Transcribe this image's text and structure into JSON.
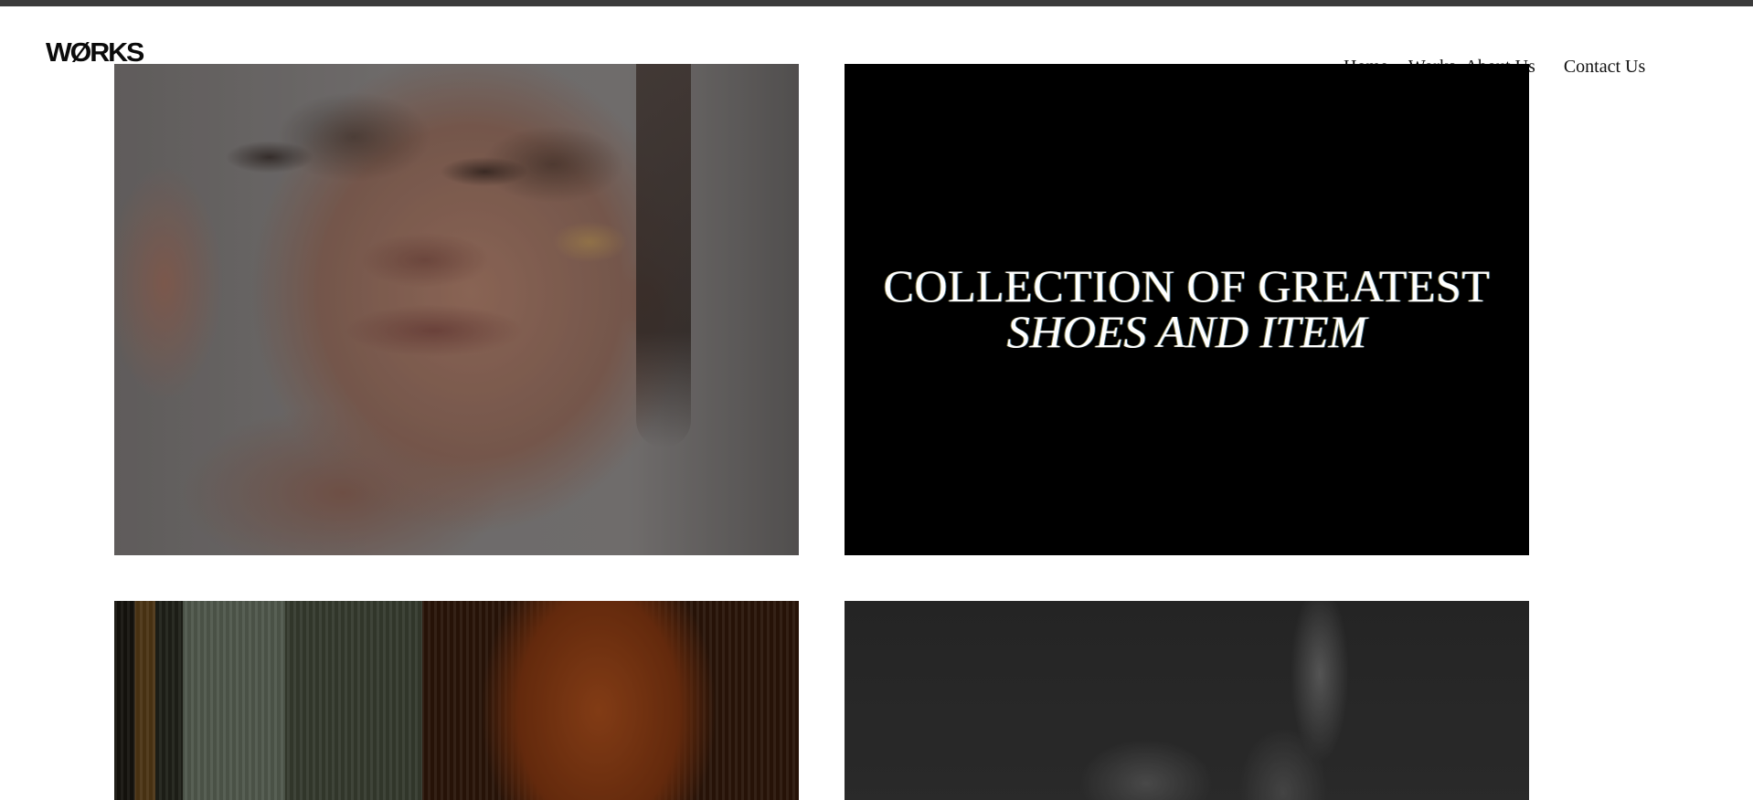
{
  "header": {
    "logo": "WØRKS",
    "nav": {
      "home": "Home",
      "works": "Works",
      "about": "About Us",
      "contact": "Contact Us"
    }
  },
  "hero_card": {
    "line1": "COLLECTION OF GREATEST",
    "line2": "SHOES AND ITEM"
  },
  "colors": {
    "top_bar": "#3b3b3b",
    "card_background": "#000000",
    "page_background": "#ffffff"
  }
}
